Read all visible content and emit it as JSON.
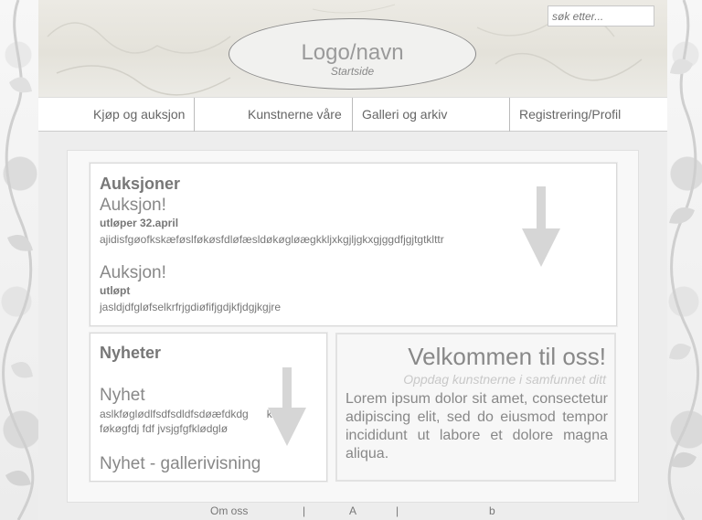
{
  "search": {
    "placeholder": "søk etter..."
  },
  "logo": {
    "title": "Logo/navn",
    "subtitle": "Startside"
  },
  "nav": {
    "items": [
      {
        "label": "Kjøp og auksjon"
      },
      {
        "label": "Kunstnerne våre"
      },
      {
        "label": "Galleri og arkiv"
      },
      {
        "label": "Registrering/Profil"
      }
    ]
  },
  "auctions": {
    "heading": "Auksjoner",
    "items": [
      {
        "title": "Auksjon!",
        "status": "utløper 32.april",
        "text": "ajidisfgøofkskæføslføkøsfdløfæsldøkøgløægkkljxkgjljgkxgjggdfjgjtgtklttr"
      },
      {
        "title": "Auksjon!",
        "status": "utløpt",
        "text": "jasldjdfgløfselkrfrjgdiøfifjgdjkfjdgjkgjre"
      }
    ]
  },
  "news": {
    "heading": "Nyheter",
    "items": [
      {
        "title": "Nyhet",
        "text_line1": "aslkføglødlfsdfsdldfsdøæfdkdg",
        "text_line1b": "kdø",
        "text_line2": "føkøgfdj fdf jvsjgfgfklødglø"
      },
      {
        "title": "Nyhet - gallerivisning"
      }
    ]
  },
  "welcome": {
    "title": "Velkommen til oss!",
    "subtitle": "Oppdag kunstnerne i samfunnet ditt",
    "body": "Lorem ipsum dolor sit amet, consectetur adipiscing elit, sed do eiusmod tempor incididunt ut labore et dolore magna aliqua."
  },
  "footer": {
    "items": [
      "Om oss",
      "|",
      "A",
      "|",
      "b"
    ]
  },
  "colors": {
    "background": "#f4f4f4",
    "text": "#777777",
    "arrow": "#d6d6d6"
  }
}
